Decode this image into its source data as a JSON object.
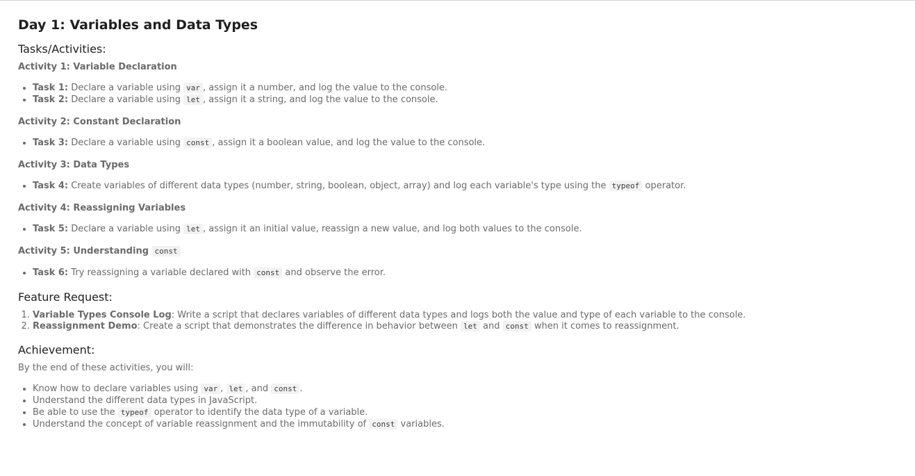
{
  "title": "Day 1: Variables and Data Types",
  "tasks_heading": "Tasks/Activities:",
  "activities": [
    {
      "heading": "Activity 1: Variable Declaration",
      "tasks": [
        {
          "label": "Task 1:",
          "pre": " Declare a variable using ",
          "code": "var",
          "post": ", assign it a number, and log the value to the console."
        },
        {
          "label": "Task 2:",
          "pre": " Declare a variable using ",
          "code": "let",
          "post": ", assign it a string, and log the value to the console."
        }
      ]
    },
    {
      "heading": "Activity 2: Constant Declaration",
      "tasks": [
        {
          "label": "Task 3:",
          "pre": " Declare a variable using ",
          "code": "const",
          "post": ", assign it a boolean value, and log the value to the console."
        }
      ]
    },
    {
      "heading": "Activity 3: Data Types",
      "tasks": [
        {
          "label": "Task 4:",
          "pre": " Create variables of different data types (number, string, boolean, object, array) and log each variable's type using the ",
          "code": "typeof",
          "post": " operator."
        }
      ]
    },
    {
      "heading": "Activity 4: Reassigning Variables",
      "tasks": [
        {
          "label": "Task 5:",
          "pre": " Declare a variable using ",
          "code": "let",
          "post": ", assign it an initial value, reassign a new value, and log both values to the console."
        }
      ]
    },
    {
      "heading": "Activity 5: Understanding ",
      "heading_code": "const",
      "tasks": [
        {
          "label": "Task 6:",
          "pre": " Try reassigning a variable declared with ",
          "code": "const",
          "post": " and observe the error."
        }
      ]
    }
  ],
  "feature_heading": "Feature Request:",
  "features": [
    {
      "label": "Variable Types Console Log",
      "text": ": Write a script that declares variables of different data types and logs both the value and type of each variable to the console."
    },
    {
      "label": "Reassignment Demo",
      "pre": ": Create a script that demonstrates the difference in behavior between ",
      "code1": "let",
      "mid": " and ",
      "code2": "const",
      "post": " when it comes to reassignment."
    }
  ],
  "achievement_heading": "Achievement:",
  "achievement_intro": "By the end of these activities, you will:",
  "achievements": [
    {
      "pre": "Know how to declare variables using ",
      "code1": "var",
      "sep1": ", ",
      "code2": "let",
      "sep2": ", and ",
      "code3": "const",
      "post": "."
    },
    {
      "text": "Understand the different data types in JavaScript."
    },
    {
      "pre": "Be able to use the ",
      "code": "typeof",
      "post": " operator to identify the data type of a variable."
    },
    {
      "pre": "Understand the concept of variable reassignment and the immutability of ",
      "code": "const",
      "post": " variables."
    }
  ]
}
